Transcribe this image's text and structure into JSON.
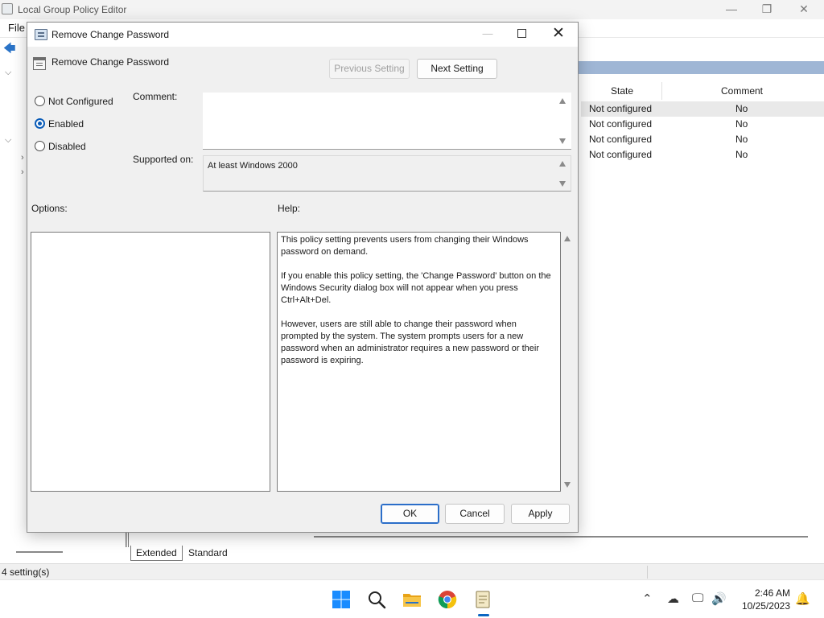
{
  "app": {
    "title": "Local Group Policy Editor",
    "menu_file": "File",
    "controls": {
      "minimize": "—",
      "restore": "❐",
      "close": "✕"
    }
  },
  "list": {
    "columns": {
      "state": "State",
      "comment": "Comment"
    },
    "rows": [
      {
        "state": "Not configured",
        "comment": "No"
      },
      {
        "state": "Not configured",
        "comment": "No"
      },
      {
        "state": "Not configured",
        "comment": "No"
      },
      {
        "state": "Not configured",
        "comment": "No"
      }
    ],
    "tabs": {
      "extended": "Extended",
      "standard": "Standard"
    }
  },
  "status": {
    "text": "4 setting(s)"
  },
  "dialog": {
    "title": "Remove Change Password",
    "policy_name": "Remove Change Password",
    "previous_setting": "Previous Setting",
    "next_setting": "Next Setting",
    "radio": {
      "not_configured": "Not Configured",
      "enabled": "Enabled",
      "disabled": "Disabled",
      "selected": "enabled"
    },
    "comment_label": "Comment:",
    "comment_value": "",
    "supported_label": "Supported on:",
    "supported_value": "At least Windows 2000",
    "options_label": "Options:",
    "help_label": "Help:",
    "help_text": [
      "This policy setting prevents users from changing their Windows password on demand.",
      "If you enable this policy setting,  the 'Change Password' button on the Windows Security dialog box will not appear when you press Ctrl+Alt+Del.",
      "However, users are still able to change their password when prompted by the system. The system prompts users for a new password when an administrator requires a new password or their password is expiring."
    ],
    "ok": "OK",
    "cancel": "Cancel",
    "apply": "Apply"
  },
  "taskbar": {
    "apps": [
      "start-icon",
      "search-icon",
      "file-explorer-icon",
      "chrome-icon",
      "notepad-icon"
    ],
    "time": "2:46 AM",
    "date": "10/25/2023"
  },
  "colors": {
    "accent": "#0a5cb8",
    "list_band": "#9fb6d5"
  }
}
